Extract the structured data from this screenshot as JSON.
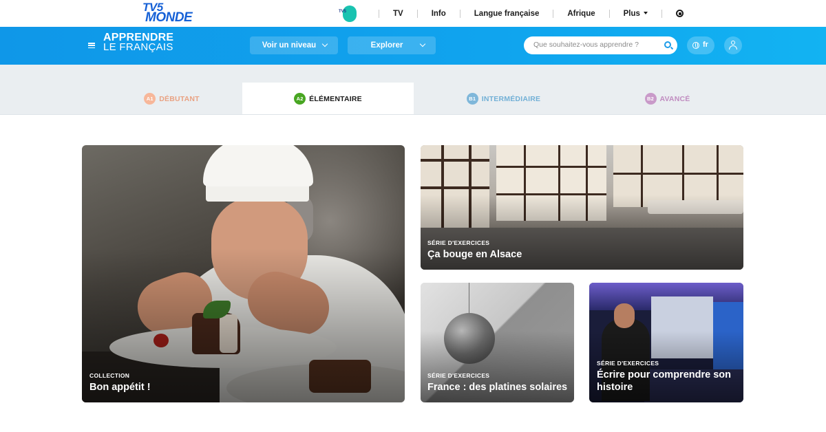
{
  "topbar": {
    "logo_line1": "TV5",
    "logo_line2": "MONDE",
    "tv5_icon_text": "TV5",
    "nav": [
      "TV",
      "Info",
      "Langue française",
      "Afrique",
      "Plus"
    ]
  },
  "header": {
    "brand_line1": "APPRENDRE",
    "brand_line2": "LE FRANÇAIS",
    "level_button": "Voir un niveau",
    "explore_button": "Explorer",
    "search_placeholder": "Que souhaitez-vous apprendre ?",
    "language": "fr"
  },
  "levels": [
    {
      "code": "A1",
      "label": "DÉBUTANT",
      "color": "#f7b79a",
      "text_color": "#e9a283"
    },
    {
      "code": "A2",
      "label": "ÉLÉMENTAIRE",
      "color": "#48a622",
      "text_color": "#1b1b1b"
    },
    {
      "code": "B1",
      "label": "INTERMÉDIAIRE",
      "color": "#7fb7da",
      "text_color": "#72b0d6"
    },
    {
      "code": "B2",
      "label": "AVANCÉ",
      "color": "#c99ac9",
      "text_color": "#c08cc0"
    }
  ],
  "cards": [
    {
      "kicker": "COLLECTION",
      "title": "Bon appétit !"
    },
    {
      "kicker": "SÉRIE D'EXERCICES",
      "title": "Ça bouge en Alsace"
    },
    {
      "kicker": "SÉRIE D'EXERCICES",
      "title": "France : des platines solaires"
    },
    {
      "kicker": "SÉRIE D'EXERCICES",
      "title_line1": "Écrire pour comprendre son",
      "title_line2": "histoire"
    }
  ]
}
